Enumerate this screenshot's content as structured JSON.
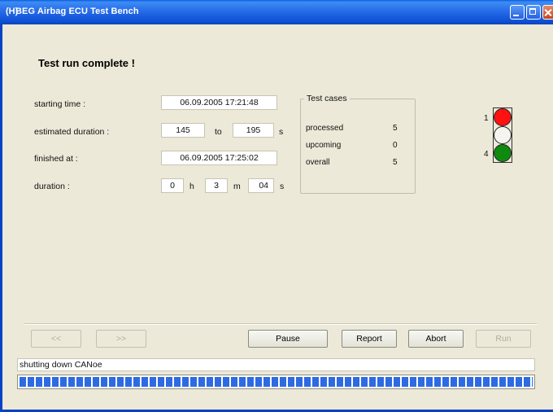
{
  "window": {
    "title_icon": "(H)",
    "title": "BEG Airbag ECU Test Bench"
  },
  "status_title": "Test run complete !",
  "form": {
    "starting_time_label": "starting time :",
    "starting_time_value": "06.09.2005 17:21:48",
    "estimated_duration_label": "estimated duration :",
    "estimated_min": "145",
    "to_label": "to",
    "estimated_max": "195",
    "estimated_unit": "s",
    "finished_at_label": "finished at :",
    "finished_at_value": "06.09.2005 17:25:02",
    "duration_label": "duration :",
    "duration_h": "0",
    "h_label": "h",
    "duration_m": "3",
    "m_label": "m",
    "duration_s": "04",
    "s_label": "s"
  },
  "test_cases": {
    "legend": "Test cases",
    "rows": [
      {
        "label": "processed",
        "value": "5"
      },
      {
        "label": "upcoming",
        "value": "0"
      },
      {
        "label": "overall",
        "value": "5"
      }
    ]
  },
  "traffic_light": {
    "top_number": "1",
    "bottom_number": "4",
    "colors": {
      "red": "#FF1111",
      "white": "#F5F5F0",
      "green": "#0F8A0F"
    }
  },
  "buttons": {
    "prev": "<<",
    "next": ">>",
    "pause": "Pause",
    "report": "Report",
    "abort": "Abort",
    "run": "Run"
  },
  "status_line": "shutting down CANoe",
  "progress": {
    "fraction": 1.0
  },
  "colors": {
    "titlebar": "#0A5BE0",
    "window_bg": "#ECE9D8",
    "progress": "#2E6BE3"
  }
}
